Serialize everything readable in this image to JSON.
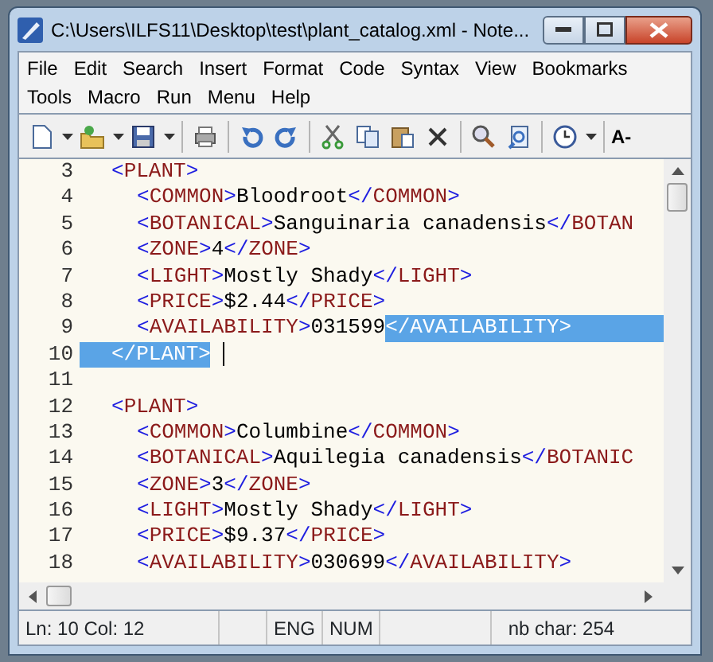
{
  "window": {
    "title": "C:\\Users\\ILFS11\\Desktop\\test\\plant_catalog.xml - Note..."
  },
  "menu": [
    [
      "File",
      "Edit",
      "Search",
      "Insert",
      "Format",
      "Code",
      "Syntax",
      "View",
      "Bookmarks"
    ],
    [
      "Tools",
      "Macro",
      "Run",
      "Menu",
      "Help"
    ]
  ],
  "toolbar": {
    "font_button": "A-"
  },
  "editor": {
    "lines": [
      {
        "number": "3",
        "kind": "element",
        "caret": false,
        "parts": [
          {
            "kind": "bracket",
            "text": "<",
            "selected": false
          },
          {
            "kind": "tag",
            "text": "PLANT",
            "selected": false
          },
          {
            "kind": "bracket",
            "text": ">",
            "selected": false
          }
        ]
      },
      {
        "number": "4",
        "kind": "child",
        "caret": false,
        "parts": [
          {
            "kind": "bracket",
            "text": "<",
            "selected": false
          },
          {
            "kind": "tag",
            "text": "COMMON",
            "selected": false
          },
          {
            "kind": "bracket",
            "text": ">",
            "selected": false
          },
          {
            "kind": "text",
            "text": "Bloodroot",
            "selected": false
          },
          {
            "kind": "bracket",
            "text": "</",
            "selected": false
          },
          {
            "kind": "tag",
            "text": "COMMON",
            "selected": false
          },
          {
            "kind": "bracket",
            "text": ">",
            "selected": false
          }
        ]
      },
      {
        "number": "5",
        "kind": "child",
        "caret": false,
        "parts": [
          {
            "kind": "bracket",
            "text": "<",
            "selected": false
          },
          {
            "kind": "tag",
            "text": "BOTANICAL",
            "selected": false
          },
          {
            "kind": "bracket",
            "text": ">",
            "selected": false
          },
          {
            "kind": "text",
            "text": "Sanguinaria canadensis",
            "selected": false
          },
          {
            "kind": "bracket",
            "text": "</",
            "selected": false
          },
          {
            "kind": "tag",
            "text": "BOTAN",
            "selected": false
          }
        ]
      },
      {
        "number": "6",
        "kind": "child",
        "caret": false,
        "parts": [
          {
            "kind": "bracket",
            "text": "<",
            "selected": false
          },
          {
            "kind": "tag",
            "text": "ZONE",
            "selected": false
          },
          {
            "kind": "bracket",
            "text": ">",
            "selected": false
          },
          {
            "kind": "text",
            "text": "4",
            "selected": false
          },
          {
            "kind": "bracket",
            "text": "</",
            "selected": false
          },
          {
            "kind": "tag",
            "text": "ZONE",
            "selected": false
          },
          {
            "kind": "bracket",
            "text": ">",
            "selected": false
          }
        ]
      },
      {
        "number": "7",
        "kind": "child",
        "caret": false,
        "parts": [
          {
            "kind": "bracket",
            "text": "<",
            "selected": false
          },
          {
            "kind": "tag",
            "text": "LIGHT",
            "selected": false
          },
          {
            "kind": "bracket",
            "text": ">",
            "selected": false
          },
          {
            "kind": "text",
            "text": "Mostly Shady",
            "selected": false
          },
          {
            "kind": "bracket",
            "text": "</",
            "selected": false
          },
          {
            "kind": "tag",
            "text": "LIGHT",
            "selected": false
          },
          {
            "kind": "bracket",
            "text": ">",
            "selected": false
          }
        ]
      },
      {
        "number": "8",
        "kind": "child",
        "caret": false,
        "parts": [
          {
            "kind": "bracket",
            "text": "<",
            "selected": false
          },
          {
            "kind": "tag",
            "text": "PRICE",
            "selected": false
          },
          {
            "kind": "bracket",
            "text": ">",
            "selected": false
          },
          {
            "kind": "text",
            "text": "$2.44",
            "selected": false
          },
          {
            "kind": "bracket",
            "text": "</",
            "selected": false
          },
          {
            "kind": "tag",
            "text": "PRICE",
            "selected": false
          },
          {
            "kind": "bracket",
            "text": ">",
            "selected": false
          }
        ]
      },
      {
        "number": "9",
        "kind": "child",
        "caret": false,
        "parts": [
          {
            "kind": "bracket",
            "text": "<",
            "selected": false
          },
          {
            "kind": "tag",
            "text": "AVAILABILITY",
            "selected": false
          },
          {
            "kind": "bracket",
            "text": ">",
            "selected": false
          },
          {
            "kind": "text",
            "text": "031599",
            "selected": false
          },
          {
            "kind": "bracket",
            "text": "</",
            "selected": true
          },
          {
            "kind": "tag",
            "text": "AVAILABILITY",
            "selected": true
          },
          {
            "kind": "bracket",
            "text": ">",
            "selected": true
          }
        ]
      },
      {
        "number": "10",
        "kind": "element",
        "caret": true,
        "parts": [
          {
            "kind": "bracket",
            "text": "</",
            "selected": true
          },
          {
            "kind": "tag",
            "text": "PLANT",
            "selected": true
          },
          {
            "kind": "bracket",
            "text": ">",
            "selected": true
          }
        ]
      },
      {
        "number": "11",
        "kind": "blank",
        "caret": false
      },
      {
        "number": "12",
        "kind": "element",
        "caret": false,
        "parts": [
          {
            "kind": "bracket",
            "text": "<",
            "selected": false
          },
          {
            "kind": "tag",
            "text": "PLANT",
            "selected": false
          },
          {
            "kind": "bracket",
            "text": ">",
            "selected": false
          }
        ]
      },
      {
        "number": "13",
        "kind": "child",
        "caret": false,
        "parts": [
          {
            "kind": "bracket",
            "text": "<",
            "selected": false
          },
          {
            "kind": "tag",
            "text": "COMMON",
            "selected": false
          },
          {
            "kind": "bracket",
            "text": ">",
            "selected": false
          },
          {
            "kind": "text",
            "text": "Columbine",
            "selected": false
          },
          {
            "kind": "bracket",
            "text": "</",
            "selected": false
          },
          {
            "kind": "tag",
            "text": "COMMON",
            "selected": false
          },
          {
            "kind": "bracket",
            "text": ">",
            "selected": false
          }
        ]
      },
      {
        "number": "14",
        "kind": "child",
        "caret": false,
        "parts": [
          {
            "kind": "bracket",
            "text": "<",
            "selected": false
          },
          {
            "kind": "tag",
            "text": "BOTANICAL",
            "selected": false
          },
          {
            "kind": "bracket",
            "text": ">",
            "selected": false
          },
          {
            "kind": "text",
            "text": "Aquilegia canadensis",
            "selected": false
          },
          {
            "kind": "bracket",
            "text": "</",
            "selected": false
          },
          {
            "kind": "tag",
            "text": "BOTANIC",
            "selected": false
          }
        ]
      },
      {
        "number": "15",
        "kind": "child",
        "caret": false,
        "parts": [
          {
            "kind": "bracket",
            "text": "<",
            "selected": false
          },
          {
            "kind": "tag",
            "text": "ZONE",
            "selected": false
          },
          {
            "kind": "bracket",
            "text": ">",
            "selected": false
          },
          {
            "kind": "text",
            "text": "3",
            "selected": false
          },
          {
            "kind": "bracket",
            "text": "</",
            "selected": false
          },
          {
            "kind": "tag",
            "text": "ZONE",
            "selected": false
          },
          {
            "kind": "bracket",
            "text": ">",
            "selected": false
          }
        ]
      },
      {
        "number": "16",
        "kind": "child",
        "caret": false,
        "parts": [
          {
            "kind": "bracket",
            "text": "<",
            "selected": false
          },
          {
            "kind": "tag",
            "text": "LIGHT",
            "selected": false
          },
          {
            "kind": "bracket",
            "text": ">",
            "selected": false
          },
          {
            "kind": "text",
            "text": "Mostly Shady",
            "selected": false
          },
          {
            "kind": "bracket",
            "text": "</",
            "selected": false
          },
          {
            "kind": "tag",
            "text": "LIGHT",
            "selected": false
          },
          {
            "kind": "bracket",
            "text": ">",
            "selected": false
          }
        ]
      },
      {
        "number": "17",
        "kind": "child",
        "caret": false,
        "parts": [
          {
            "kind": "bracket",
            "text": "<",
            "selected": false
          },
          {
            "kind": "tag",
            "text": "PRICE",
            "selected": false
          },
          {
            "kind": "bracket",
            "text": ">",
            "selected": false
          },
          {
            "kind": "text",
            "text": "$9.37",
            "selected": false
          },
          {
            "kind": "bracket",
            "text": "</",
            "selected": false
          },
          {
            "kind": "tag",
            "text": "PRICE",
            "selected": false
          },
          {
            "kind": "bracket",
            "text": ">",
            "selected": false
          }
        ]
      },
      {
        "number": "18",
        "kind": "child",
        "caret": false,
        "parts": [
          {
            "kind": "bracket",
            "text": "<",
            "selected": false
          },
          {
            "kind": "tag",
            "text": "AVAILABILITY",
            "selected": false
          },
          {
            "kind": "bracket",
            "text": ">",
            "selected": false
          },
          {
            "kind": "text",
            "text": "030699",
            "selected": false
          },
          {
            "kind": "bracket",
            "text": "</",
            "selected": false
          },
          {
            "kind": "tag",
            "text": "AVAILABILITY",
            "selected": false
          },
          {
            "kind": "bracket",
            "text": ">",
            "selected": false
          }
        ]
      }
    ]
  },
  "status_bar": {
    "position": "Ln: 10 Col: 12",
    "language": "ENG",
    "num_lock": "NUM",
    "char_count": "nb char: 254"
  }
}
